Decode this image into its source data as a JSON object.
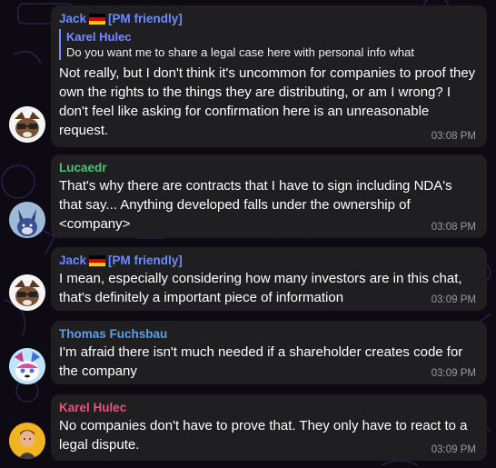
{
  "colors": {
    "jack": "#6b8cff",
    "lucaedr": "#4cc277",
    "thomas": "#5b9eea",
    "karel": "#e4567d",
    "reply_bar": "#7b8bff"
  },
  "messages": [
    {
      "author": "Jack",
      "author_suffix": "[PM friendly]",
      "flag_icon": "germany-flag-icon",
      "reply_author": "Karel Hulec",
      "reply_text": "Do you want me to share a legal case here with personal info what",
      "text": "Not really, but I don't think it's uncommon for companies to proof they own the rights to the things they are distributing, or am I wrong? I don't feel like asking for confirmation here is an unreasonable request.",
      "time": "03:08 PM"
    },
    {
      "author": "Lucaedr",
      "text": "That's why there are contracts that I have to sign including NDA's that say... Anything developed falls under the ownership of <company>",
      "time": "03:08 PM"
    },
    {
      "author": "Jack",
      "author_suffix": "[PM friendly]",
      "flag_icon": "germany-flag-icon",
      "text": "I mean, especially considering how many investors are in this chat, that's definitely a important piece of information",
      "time": "03:09 PM"
    },
    {
      "author": "Thomas Fuchsbau",
      "text": "I'm afraid there isn't much needed if a shareholder creates code for the company",
      "time": "03:09 PM"
    },
    {
      "author": "Karel Hulec",
      "text": "No companies don't have to prove that. They only have to react to a legal dispute.",
      "time": "03:09 PM"
    }
  ]
}
